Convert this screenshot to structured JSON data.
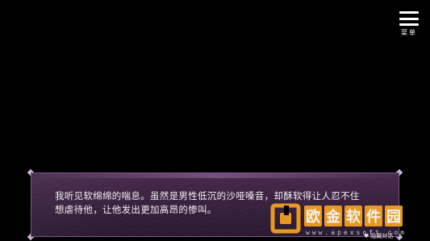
{
  "menu": {
    "label": "菜单",
    "icon": "hamburger-icon"
  },
  "dialogue": {
    "text": "我听见软绵绵的喘息。虽然是男性低沉的沙哑嗓音，却酥软得让人忍不住\n想虐待他，让他发出更加高昂的惨叫。"
  },
  "hide_dialog": {
    "icon": "heart-icon",
    "label": "隐藏对话"
  },
  "watermark": {
    "chars": [
      "欧",
      "金",
      "软",
      "件",
      "园"
    ],
    "url": "www.apexsoft.com",
    "color": "#f2a01f"
  }
}
